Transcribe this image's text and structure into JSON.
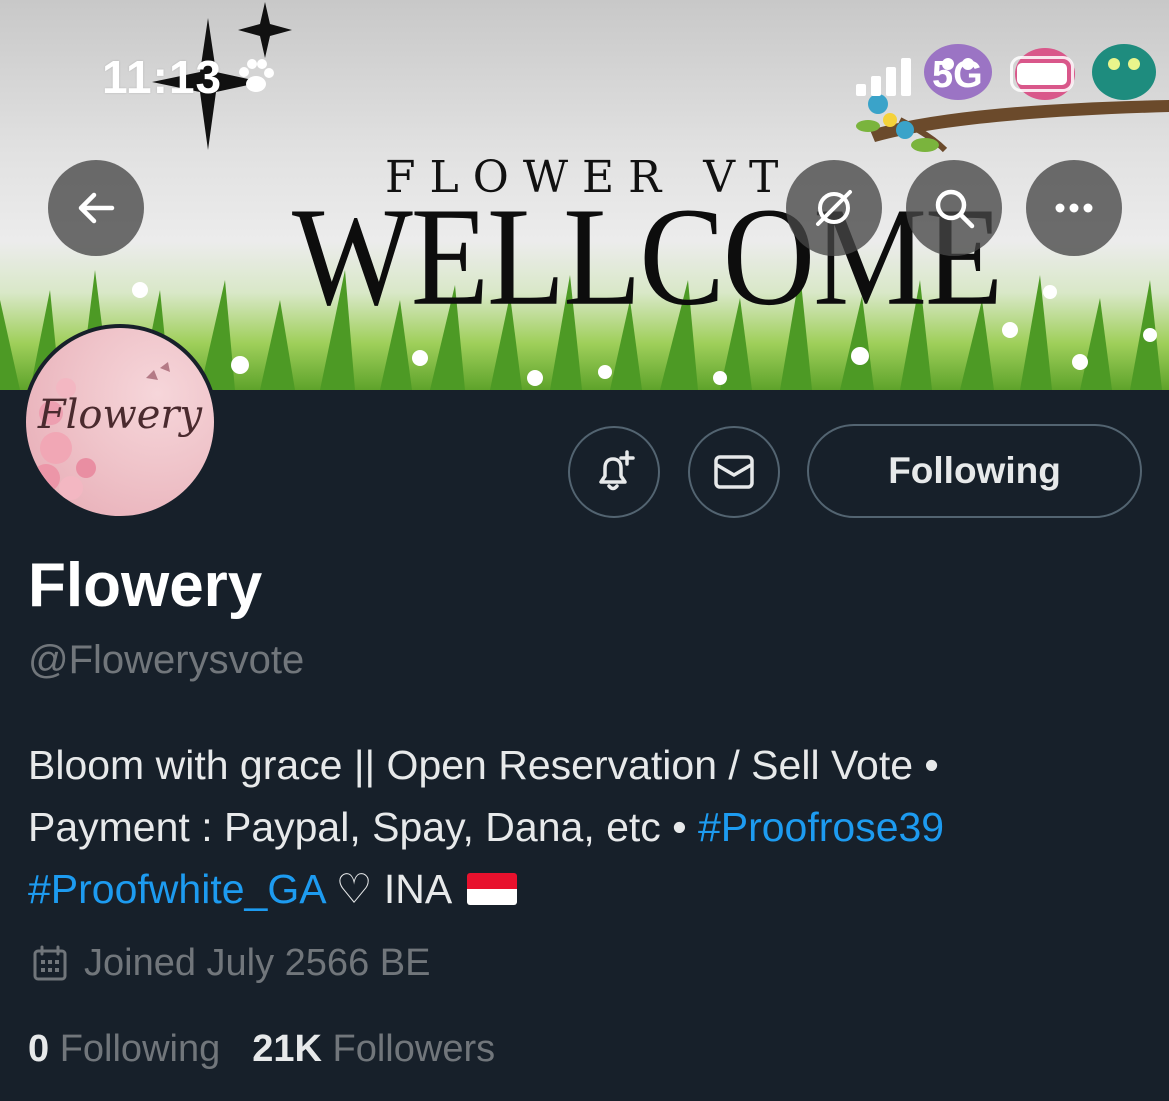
{
  "status_bar": {
    "time": "11:13",
    "network": "5G",
    "icons": [
      "paw-icon",
      "signal-icon",
      "battery-icon"
    ]
  },
  "banner": {
    "subtitle": "FLOWER VT",
    "title": "WELLCOME",
    "buttons": {
      "back": "back-arrow-icon",
      "translate": "no-translate-icon",
      "search": "search-icon",
      "more": "more-icon"
    }
  },
  "avatar": {
    "text": "Flowery"
  },
  "actions": {
    "notify_icon": "bell-plus-icon",
    "message_icon": "mail-icon",
    "following_label": "Following"
  },
  "profile": {
    "display_name": "Flowery",
    "handle": "@Flowerysvote",
    "bio": {
      "line1": "Bloom with grace || Open Reservation / Sell Vote •",
      "line2_text": "Payment : Paypal, Spay, Dana, etc • ",
      "hashtag1": "#Proofrose39",
      "hashtag2": "#Proofwhite_GA",
      "line3_tail": " ♡ INA "
    },
    "joined": "Joined July 2566 BE",
    "following_count": "0",
    "following_label": "Following",
    "followers_count": "21K",
    "followers_label": "Followers"
  },
  "colors": {
    "background": "#17202a",
    "text_primary": "#e7e9ea",
    "text_secondary": "#71767b",
    "link": "#1d9bf0",
    "border": "#536471"
  }
}
